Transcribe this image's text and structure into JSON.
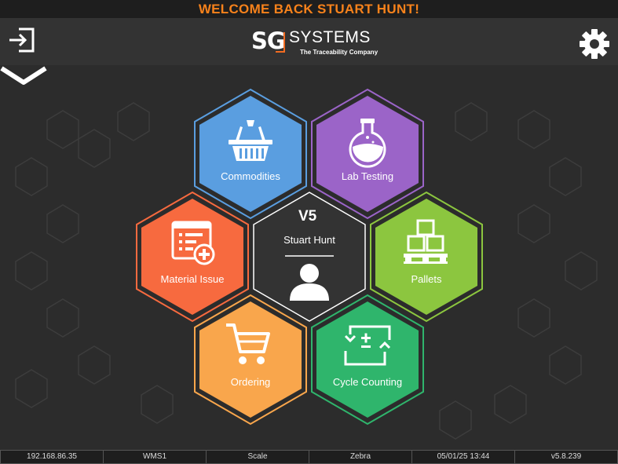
{
  "welcome": "WELCOME BACK STUART HUNT!",
  "header": {
    "logo_sg": "SG",
    "logo_systems": "SYSTEMS",
    "logo_tagline": "The Traceability Company",
    "logout_icon": "logout-icon",
    "settings_icon": "gear-icon"
  },
  "menu": {
    "commodities": "Commodities",
    "lab_testing": "Lab Testing",
    "material_issue": "Material Issue",
    "pallets": "Pallets",
    "ordering": "Ordering",
    "cycle_counting": "Cycle Counting"
  },
  "profile": {
    "version_badge": "V5",
    "user_name": "Stuart Hunt"
  },
  "colors": {
    "commodities": "#5a9ee0",
    "lab_testing": "#9b64c8",
    "material_issue": "#f76a3f",
    "pallets": "#8cc63f",
    "ordering": "#f9a64c",
    "cycle_counting": "#2fb56c",
    "accent": "#f7821b"
  },
  "status": {
    "ip": "192.168.86.35",
    "station": "WMS1",
    "scale": "Scale",
    "printer": "Zebra",
    "datetime": "05/01/25 13:44",
    "version": "v5.8.239"
  }
}
